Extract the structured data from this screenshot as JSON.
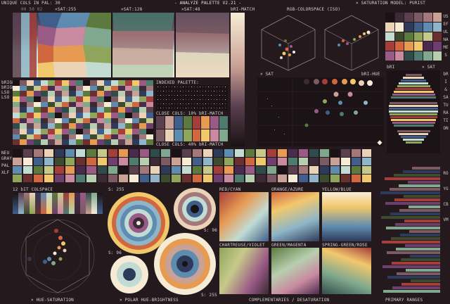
{
  "header": {
    "unique_cols_label": "UNIQUE COLS IN PAL:",
    "unique_cols_count": "30",
    "sat_ticks": "00 50 02",
    "xsat255": "×SAT:255",
    "xsat128": "×SAT:128",
    "xsat48": "×SAT:48",
    "title": "- ANALYZE PALETTE V2.21 -",
    "rgb_colorspace": "RGB-COLORSPACE (ISO)",
    "saturation_model": "× SATURATION MODEL: PURIST"
  },
  "left_labels": {
    "bri_match": "bRI-MATCH",
    "bright": "bRIGH",
    "bright2": "bRIGH",
    "lso": "LSO",
    "lso2": "LSO",
    "neu": "NEU",
    "gray": "GRAY",
    "pal": "PAL",
    "xlf": "XLF"
  },
  "panels": {
    "indexed_palette": "INDEXED PALETTE:",
    "close_cols_10": "CLOSE COLS: 10% bRI-MATCH",
    "close_cols_40": "CLOSE COLS: 40% bRI-MATCH",
    "x_sat": "× SAT",
    "bri_hue": "bRI-HUE",
    "bri": "bRI",
    "x_sat2": "× SAT",
    "color_space_12bit": "12 bIT COLSPACE",
    "s255": "S: 255",
    "s96": "S: 96",
    "s96b": "S: 96",
    "s255b": "S: 255",
    "red_cyan": "RED/CYAN",
    "orange_azure": "ORANGE/AZURE",
    "yellow_blue": "YELLOW/BLUE",
    "chartreuse_violet": "CHARTREUSE/VIOLET",
    "green_magenta": "GREEN/MAGENTA",
    "spring_rose": "SPRING-GREEN/ROSE"
  },
  "right_vertical": {
    "useful_names": "USEFUL NAMES",
    "sat_saturation": "bRI & SATURATION",
    "hues": "ROYGCBVM"
  },
  "footer": {
    "hue_saturation": "× HUE-SATURATION",
    "polar_hue": "× POLAR HUE-BRIGHTNESS",
    "complementaries": "COMPLEMENTARIES / DESATURATION",
    "primary_ranges": "PRIMARY RANGES"
  },
  "palette": [
    "#1a1214",
    "#3b2a36",
    "#5a3f4f",
    "#7b5a63",
    "#a3787a",
    "#caa295",
    "#ead3b7",
    "#f6ecd6",
    "#2e3a5a",
    "#3f5f8a",
    "#5e8bb0",
    "#8fb6c8",
    "#c2dcd3",
    "#3c4a2e",
    "#5d7a3e",
    "#8ea55b",
    "#c7c98a",
    "#6a2f2f",
    "#a33e3a",
    "#d0673f",
    "#e69a52",
    "#f2c86d",
    "#4a2a4e",
    "#6e3f6e",
    "#9a5a86",
    "#c98aa0",
    "#2f4c4a",
    "#4f7a6e",
    "#7fa88e",
    "#b7cfb0"
  ],
  "colors": {
    "bg": "#241a1d",
    "panel": "#1b1316",
    "text": "#d8d0d2",
    "accent": "#f2c86d"
  }
}
